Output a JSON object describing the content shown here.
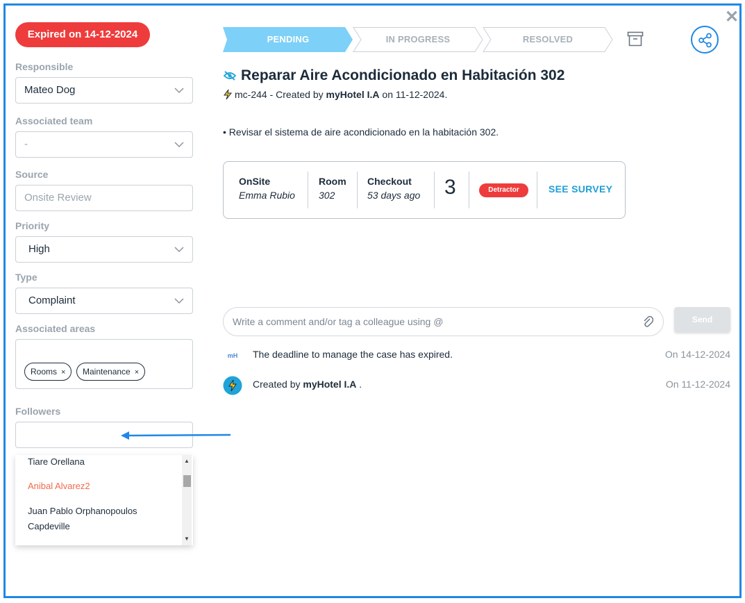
{
  "close_glyph": "✕",
  "expired_badge": "Expired on 14-12-2024",
  "sidebar": {
    "responsible": {
      "label": "Responsible",
      "value": "Mateo Dog"
    },
    "team": {
      "label": "Associated team",
      "value": "-"
    },
    "source": {
      "label": "Source",
      "placeholder": "Onsite Review"
    },
    "priority": {
      "label": "Priority",
      "value": "High"
    },
    "type": {
      "label": "Type",
      "value": "Complaint"
    },
    "areas": {
      "label": "Associated areas",
      "chips": [
        "Rooms",
        "Maintenance"
      ],
      "remove_glyph": "×"
    },
    "followers": {
      "label": "Followers",
      "value": "",
      "options": [
        "Tiare Orellana",
        "Anibal Alvarez2",
        "Juan Pablo Orphanopoulos",
        "Capdeville"
      ]
    }
  },
  "stepper": {
    "steps": [
      "PENDING",
      "IN PROGRESS",
      "RESOLVED"
    ],
    "active": "PENDING"
  },
  "case": {
    "title": "Reparar Aire Acondicionado en Habitación 302",
    "meta_prefix": "mc-244 - Created by ",
    "meta_author": "myHotel I.A",
    "meta_suffix": " on 11-12-2024.",
    "description": "• Revisar el sistema de aire acondicionado en la habitación 302."
  },
  "guest": {
    "source_h": "OnSite",
    "source_v": "Emma Rubio",
    "room_h": "Room",
    "room_v": "302",
    "checkout_h": "Checkout",
    "checkout_v": "53 days ago",
    "score": "3",
    "badge": "Detractor",
    "survey_link": "SEE SURVEY"
  },
  "comment": {
    "placeholder": "Write a comment and/or tag a colleague using @",
    "send": "Send"
  },
  "log": [
    {
      "icon": "mH",
      "text": "The deadline to manage the case has expired.",
      "date": "On 14-12-2024"
    },
    {
      "text_prefix": "Created by ",
      "text_bold": "myHotel I.A",
      "text_suffix": " .",
      "date": "On 11-12-2024"
    }
  ],
  "colors": {
    "accent": "#1f87e6",
    "danger": "#ee3c3c",
    "pending": "#7dd0f7",
    "link": "#1f9fd6"
  }
}
